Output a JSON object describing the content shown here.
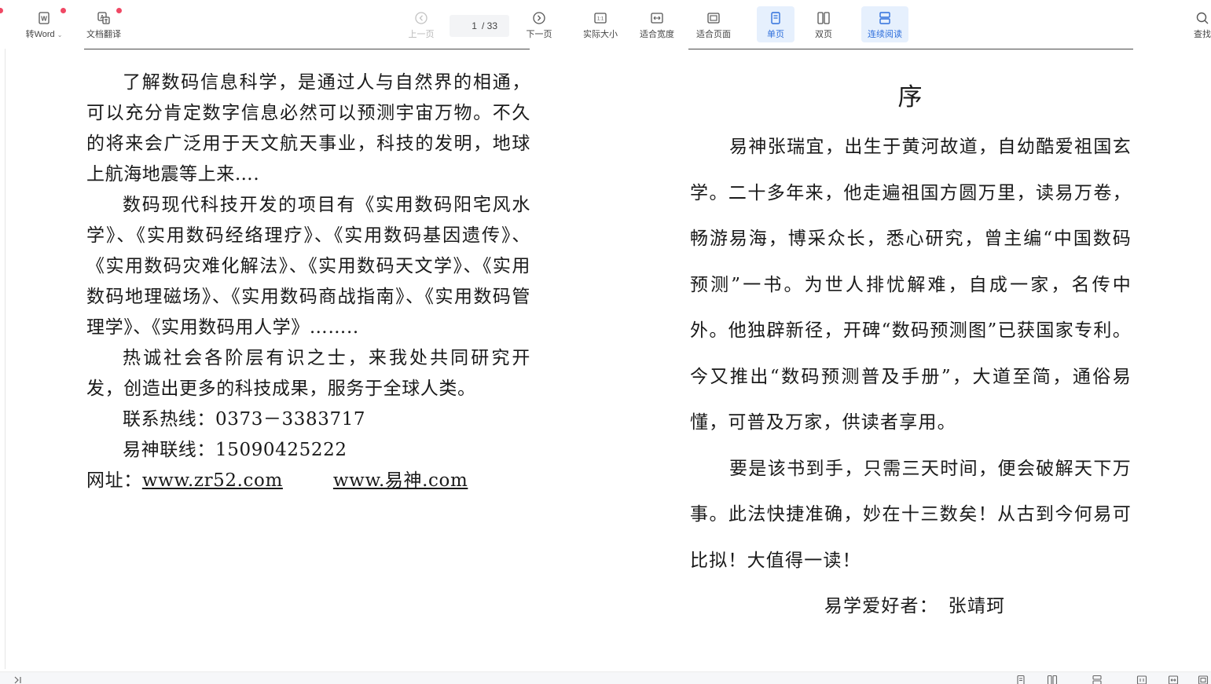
{
  "toolbar": {
    "convert_word": "转Word",
    "translate": "文档翻译",
    "prev_page": "上一页",
    "page_current": "1",
    "page_total": "/ 33",
    "next_page": "下一页",
    "actual_size": "实际大小",
    "fit_width": "适合宽度",
    "fit_page": "适合页面",
    "single_page": "单页",
    "double_page": "双页",
    "continuous": "连续阅读",
    "find": "查找",
    "actual_size_glyph": "1:1"
  },
  "colors": {
    "accent": "#2f6fdc",
    "active_bg": "#e6f0fd",
    "badge": "#f04864"
  },
  "left_page": {
    "p1": "了解数码信息科学，是通过人与自然界的相通，可以充分肯定数字信息必然可以预测宇宙万物。不久的将来会广泛用于天文航天事业，科技的发明，地球上航海地震等上来….",
    "p2": "数码现代科技开发的项目有《实用数码阳宅风水学》、《实用数码经络理疗》、《实用数码基因遗传》、《实用数码灾难化解法》、《实用数码天文学》、《实用数码地理磁场》、《实用数码商战指南》、《实用数码管理学》、《实用数码用人学》……..",
    "p3": "热诚社会各阶层有识之士，来我处共同研究开发，创造出更多的科技成果，服务于全球人类。",
    "hotline": "联系热线：0373－3383717",
    "yishen_line": "易神联线：15090425222",
    "site_label": "网址：",
    "site1": "www.zr52.com",
    "site2": "www.易神.com"
  },
  "right_page": {
    "title": "序",
    "p1": "易神张瑞宜，出生于黄河故道，自幼酷爱祖国玄学。二十多年来，他走遍祖国方圆万里，读易万卷，畅游易海，博采众长，悉心研究，曾主编“中国数码预测”一书。为世人排忧解难，自成一家，名传中外。他独辟新径，开碑“数码预测图”已获国家专利。今又推出“数码预测普及手册”，大道至简，通俗易懂，可普及万家，供读者享用。",
    "p2": "要是该书到手，只需三天时间，便会破解天下万事。此法快捷准确，妙在十三数矣！从古到今何易可比拟！大值得一读！",
    "signature": "易学爱好者：　张靖珂"
  }
}
